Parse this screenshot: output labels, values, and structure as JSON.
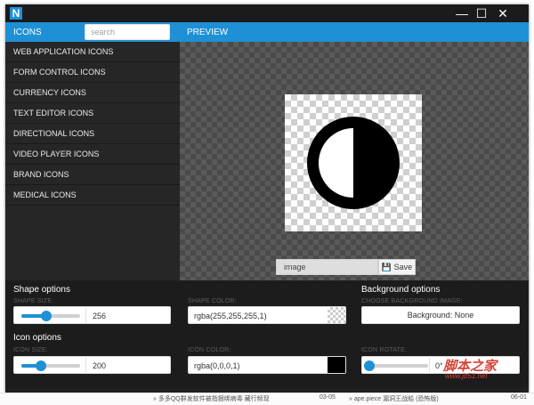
{
  "app": {
    "logo_letter": "N"
  },
  "window_controls": {
    "minimize": "—",
    "maximize": "☐",
    "close": "✕"
  },
  "tabs": {
    "icons": "ICONS",
    "preview": "PREVIEW"
  },
  "search": {
    "placeholder": "search",
    "value": ""
  },
  "categories": [
    "WEB APPLICATION ICONS",
    "FORM CONTROL ICONS",
    "CURRENCY ICONS",
    "TEXT EDITOR ICONS",
    "DIRECTIONAL ICONS",
    "VIDEO PLAYER ICONS",
    "BRAND ICONS",
    "MEDICAL ICONS"
  ],
  "preview": {
    "icon_name": "adjust-icon",
    "file_name": "image",
    "save_label": "Save"
  },
  "shape_options": {
    "title": "Shape options",
    "size_label": "SHAPE SIZE:",
    "size_value": "256",
    "size_level": 0.42,
    "color_label": "SHAPE COLOR:",
    "color_value": "rgba(255,255,255,1)"
  },
  "icon_options": {
    "title": "Icon options",
    "size_label": "ICON SIZE:",
    "size_value": "200",
    "size_level": 0.33,
    "color_label": "ICON COLOR:",
    "color_value": "rgba(0,0,0,1)",
    "color_swatch": "#000000",
    "rotate_label": "ICON ROTATE:",
    "rotate_value": "0°",
    "rotate_level": 0.0
  },
  "background_options": {
    "title": "Background options",
    "image_label": "CHOOSE BACKGROUND IMAGE:",
    "button_label": "Background: None"
  },
  "colors": {
    "accent": "#1e90d6",
    "panel": "#1c1c1c",
    "sidebar": "#262626"
  },
  "taskbar": {
    "left_text": "» 多多QQ群发软件被指捆绑病毒 藏行频现",
    "left_time": "03-05",
    "right_text": "» ape.piece 漏洞王战船 (恐怖版)",
    "right_time": "06-01"
  },
  "watermark": {
    "brand": "脚本之家",
    "url": "www.jb51.net"
  }
}
